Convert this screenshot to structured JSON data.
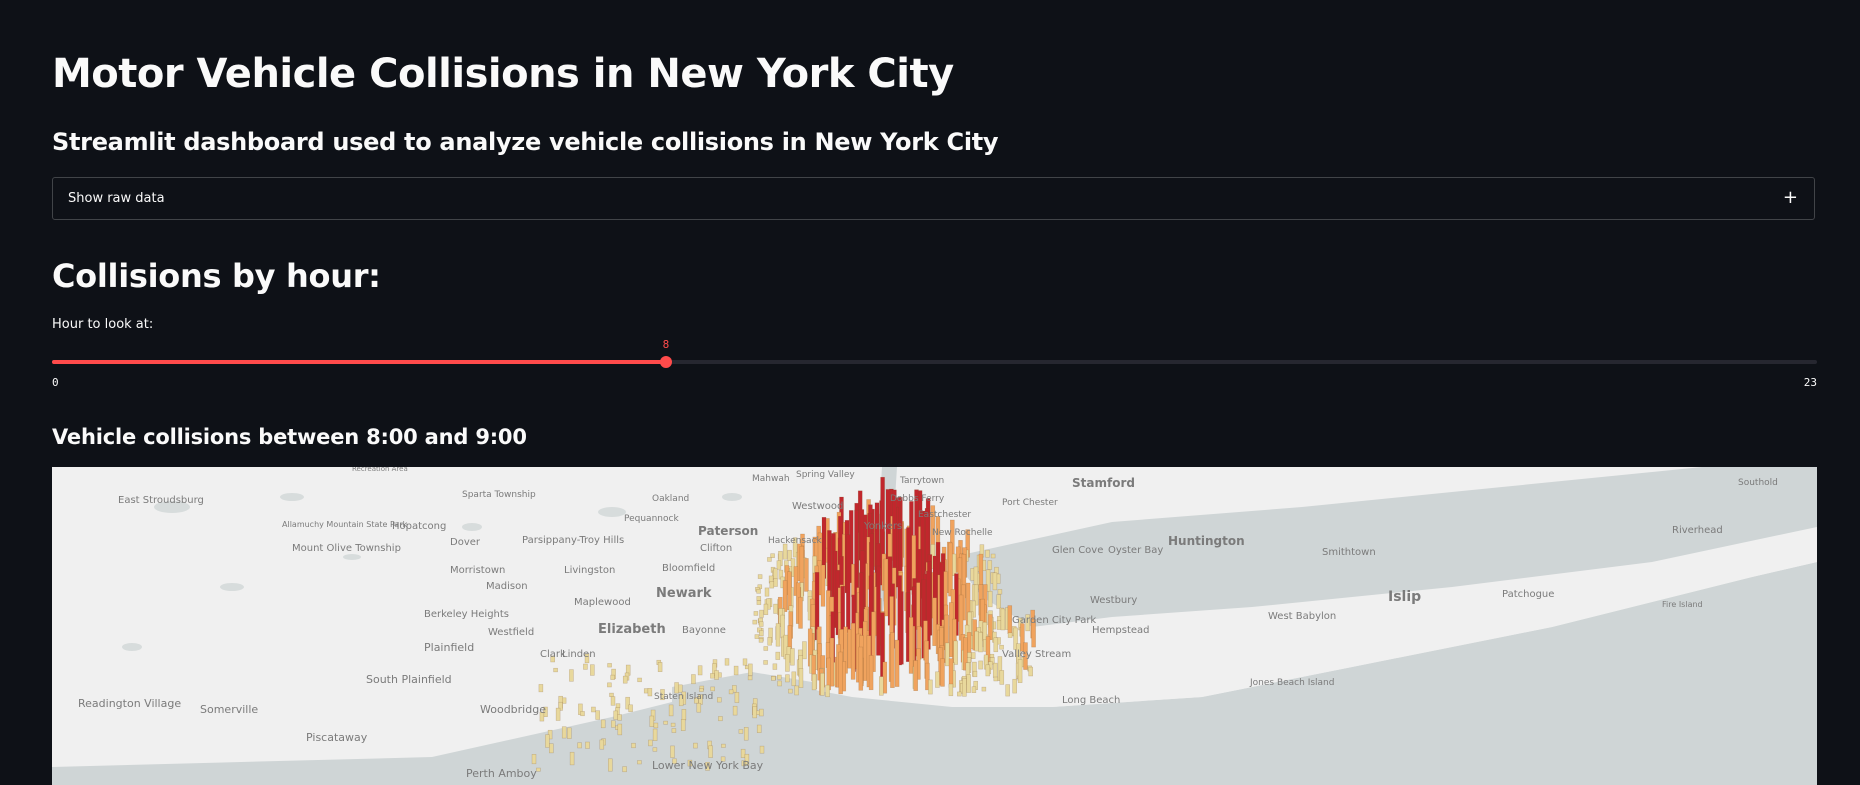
{
  "page": {
    "title": "Motor Vehicle Collisions in New York City",
    "subtitle": "Streamlit dashboard used to analyze vehicle collisions in New York City"
  },
  "expander": {
    "label": "Show raw data",
    "icon": "plus-icon"
  },
  "hour_section": {
    "heading": "Collisions by hour:",
    "slider": {
      "label": "Hour to look at:",
      "min": 0,
      "max": 23,
      "value": 8,
      "min_label": "0",
      "max_label": "23",
      "value_label": "8"
    }
  },
  "map_section": {
    "heading": "Vehicle collisions between 8:00 and 9:00",
    "places": [
      "Stamford",
      "Paterson",
      "Newark",
      "Elizabeth",
      "Huntington",
      "Islip",
      "Plainfield",
      "Clifton",
      "Bloomfield",
      "Morristown",
      "Westfield",
      "Linden",
      "Bayonne",
      "Staten Island",
      "Woodbridge",
      "South Plainfield",
      "Piscataway",
      "Somerville",
      "Readington Village",
      "Berkeley Heights",
      "Madison",
      "Livingston",
      "Maplewood",
      "Clark",
      "Dover",
      "Parsippany-Troy Hills",
      "Mount Olive Township",
      "Allamuchy Mountain State Park",
      "East Stroudsburg",
      "Sparta Township",
      "Hopatcong",
      "Oakland",
      "Pequannock",
      "Mahwah",
      "Spring Valley",
      "Tarrytown",
      "Dobbs Ferry",
      "Westwood",
      "Hackensack",
      "Yonkers",
      "Eastchester",
      "New Rochelle",
      "Port Chester",
      "Glen Cove",
      "Oyster Bay",
      "Smithtown",
      "Riverhead",
      "Southold",
      "Patchogue",
      "Fire Island",
      "West Babylon",
      "Jones Beach Island",
      "Long Beach",
      "Hempstead",
      "Westbury",
      "Valley Stream",
      "Garden City Park",
      "Perth Amboy",
      "Lower New York Bay",
      "Recreation Area"
    ],
    "colors": {
      "accent": "#ff4b4b",
      "bar_low": "#e8d89c",
      "bar_mid": "#f0a35e",
      "bar_high": "#c1272d"
    }
  }
}
